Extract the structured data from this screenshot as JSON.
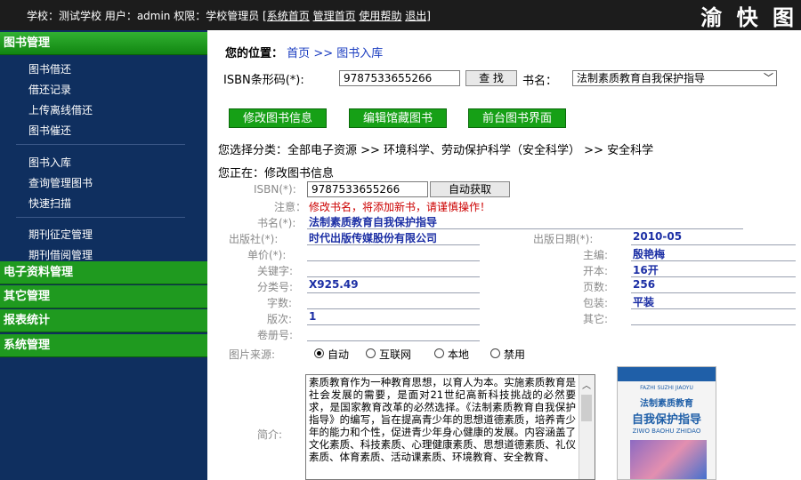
{
  "topbar": {
    "info": "学校：测试学校 用户：admin 权限：学校管理员 ",
    "links": [
      "[系统首页",
      "管理首页",
      "使用帮助",
      "退出]"
    ],
    "brand": "渝 快 图"
  },
  "sidebar": {
    "sections": [
      "图书管理",
      "电子资料管理",
      "其它管理",
      "报表统计",
      "系统管理"
    ],
    "items_group1": [
      "图书借还",
      "借还记录",
      "上传离线借还",
      "图书催还"
    ],
    "items_group2": [
      "图书入库",
      "查询管理图书",
      "快速扫描"
    ],
    "items_group3": [
      "期刊征定管理",
      "期刊借阅管理"
    ]
  },
  "crumb": {
    "label": "您的位置：",
    "home": "首页",
    "sep": ">>",
    "current": "图书入库"
  },
  "isbn_search": {
    "label": "ISBN条形码(*):",
    "value": "9787533655266",
    "search_btn": "查 找",
    "title_label": "书名：",
    "title_value": "法制素质教育自我保护指导"
  },
  "actions": [
    "修改图书信息",
    "编辑馆藏图书",
    "前台图书界面"
  ],
  "category": "您选择分类：全部电子资源 >> 环境科学、劳动保护科学（安全科学） >> 安全科学",
  "status": "您正在：修改图书信息",
  "form": {
    "isbn_label": "ISBN(*):",
    "isbn_value": "9787533655266",
    "auto_btn": "自动获取",
    "note_label": "注意：",
    "note_text": "修改书名，将添加新书，请谨慎操作！",
    "title_label": "书名(*):",
    "title_value": "法制素质教育自我保护指导",
    "publisher_label": "出版社(*):",
    "publisher_value": "时代出版传媒股份有限公司",
    "pubdate_label": "出版日期(*):",
    "pubdate_value": "2010-05",
    "price_label": "单价(*):",
    "price_value": "",
    "editor_label": "主编:",
    "editor_value": "殷艳梅",
    "keywords_label": "关键字:",
    "keywords_value": "",
    "format_label": "开本:",
    "format_value": "16开",
    "classno_label": "分类号:",
    "classno_value": "X925.49",
    "pages_label": "页数:",
    "pages_value": "256",
    "wordcount_label": "字数:",
    "wordcount_value": "",
    "binding_label": "包装:",
    "binding_value": "平装",
    "edition_label": "版次:",
    "edition_value": "1",
    "other_label": "其它:",
    "other_value": "",
    "volumes_label": "卷册号:",
    "volumes_value": "",
    "img_source_label": "图片来源:",
    "img_source_options": [
      "自动",
      "互联网",
      "本地",
      "禁用"
    ],
    "img_source_selected": 0,
    "intro_label": "简介:",
    "intro_text": "素质教育作为一种教育思想，以育人为本。实施素质教育是社会发展的需要，是面对21世纪高新科技挑战的必然要求，是国家教育改革的必然选择。《法制素质教育自我保护指导》的编写，旨在提高青少年的思想道德素质，培养青少年的能力和个性，促进青少年身心健康的发展。内容涵盖了文化素质、科技素质、心理健康素质、思想道德素质、礼仪素质、体育素质、活动课素质、环境教育、安全教育、"
  },
  "cover": {
    "pinyin": "FAZHI SUZHI JIAOYU",
    "line1": "法制素质教育",
    "line2": "自我保护指导",
    "pinyin2": "ZIWO BAOHU ZHIDAO",
    "accent_color": "#1f5fa8"
  }
}
